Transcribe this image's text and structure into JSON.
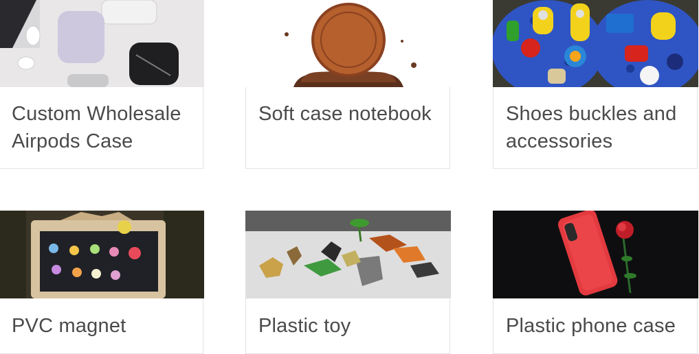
{
  "products": [
    {
      "title": "Custom Wholesale Airpods Case"
    },
    {
      "title": "Soft case notebook"
    },
    {
      "title": "Shoes buckles and accessories"
    },
    {
      "title": "PVC magnet"
    },
    {
      "title": "Plastic toy"
    },
    {
      "title": "Plastic phone case"
    }
  ],
  "colors": {
    "title_text": "#4a4a4a",
    "card_border": "#e3e3e3"
  }
}
